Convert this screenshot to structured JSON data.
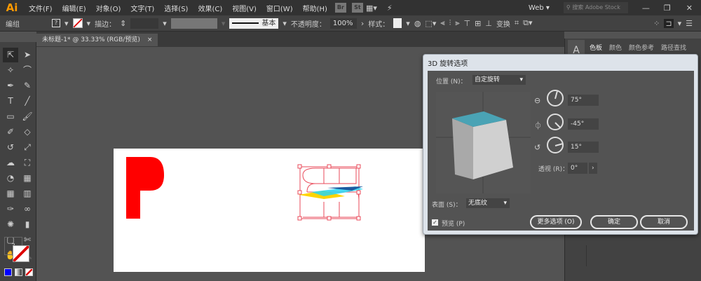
{
  "app": {
    "logo": "Ai",
    "menus": [
      "文件(F)",
      "编辑(E)",
      "对象(O)",
      "文字(T)",
      "选择(S)",
      "效果(C)",
      "视图(V)",
      "窗口(W)",
      "帮助(H)"
    ],
    "bridge": "Br",
    "stock": "St",
    "workspace": "Web",
    "search_placeholder": "搜索 Adobe Stock",
    "window_buttons": [
      "minimize",
      "restore",
      "close"
    ]
  },
  "control": {
    "mode": "编组",
    "stroke_label": "描边：",
    "brush": "基本",
    "opacity_label": "不透明度：",
    "opacity": "100%",
    "style_label": "样式：",
    "transform": "变换"
  },
  "document": {
    "tab": "未标题-1* @ 33.33% (RGB/预览)",
    "close": "×"
  },
  "panel": {
    "tabs": [
      "色板",
      "颜色",
      "颜色参考",
      "路径查找"
    ]
  },
  "tools": [
    "selection",
    "direct-selection",
    "magic-wand",
    "lasso",
    "pen",
    "curvature",
    "type",
    "line",
    "rectangle",
    "paintbrush",
    "shaper",
    "eraser",
    "rotate",
    "scale",
    "warp",
    "free-transform",
    "shape-builder",
    "perspective",
    "mesh",
    "gradient",
    "eyedropper",
    "blend",
    "symbol-sprayer",
    "column-graph",
    "artboard",
    "slice",
    "hand",
    "zoom"
  ],
  "tool_glyphs": [
    "⇱",
    "➤",
    "✧",
    "⌒",
    "✒",
    "✎",
    "T",
    "╱",
    "▭",
    "🖌",
    "✐",
    "◇",
    "↺",
    "⤢",
    "☁",
    "⛶",
    "◔",
    "▦",
    "▦",
    "▥",
    "✑",
    "∞",
    "✺",
    "▮",
    "▢",
    "✄",
    "✋",
    "🔍"
  ],
  "swatches": {
    "fill": "#0000ff",
    "none": "none",
    "colors": {
      "accent": "#4aa3b5",
      "artwork_red": "#ff0000"
    }
  },
  "dialog": {
    "title": "3D 旋转选项",
    "position_label": "位置 (N)：",
    "position_value": "自定旋转",
    "x_angle": "75°",
    "y_angle": "-45°",
    "z_angle": "15°",
    "perspective_label": "透视 (R)：",
    "perspective": "0°",
    "surface_label": "表面 (S)：",
    "surface_value": "无底纹",
    "preview_label": "预览 (P)",
    "preview_checked": true,
    "more": "更多选项 (O)",
    "ok": "确定",
    "cancel": "取消"
  }
}
